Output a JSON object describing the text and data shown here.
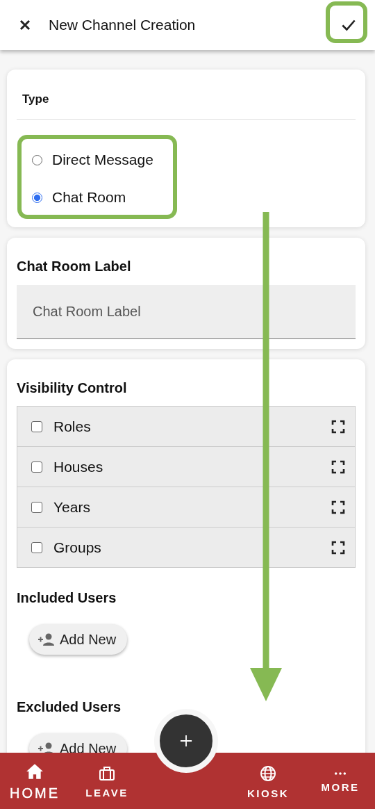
{
  "header": {
    "title": "New Channel Creation"
  },
  "type_card": {
    "title": "Type",
    "options": [
      {
        "label": "Direct Message",
        "selected": false
      },
      {
        "label": "Chat Room",
        "selected": true
      }
    ]
  },
  "label_card": {
    "title": "Chat Room Label",
    "placeholder": "Chat Room Label"
  },
  "visibility": {
    "title": "Visibility Control",
    "items": [
      {
        "label": "Roles",
        "checked": false
      },
      {
        "label": "Houses",
        "checked": false
      },
      {
        "label": "Years",
        "checked": false
      },
      {
        "label": "Groups",
        "checked": false
      }
    ]
  },
  "included": {
    "title": "Included Users",
    "button": "Add New"
  },
  "excluded": {
    "title": "Excluded Users",
    "button": "Add New"
  },
  "nav": [
    {
      "label": "HOME",
      "kind": "home",
      "selected": true
    },
    {
      "label": "LEAVE",
      "kind": "leave",
      "selected": false
    },
    {
      "label": "KIOSK",
      "kind": "kiosk",
      "selected": false
    },
    {
      "label": "MORE",
      "kind": "more",
      "selected": false
    }
  ]
}
